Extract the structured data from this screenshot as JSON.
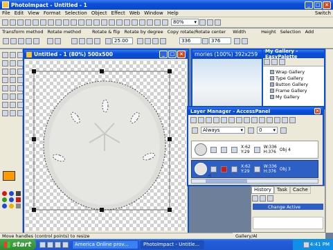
{
  "app": {
    "title": "PhotoImpact - Untitled - 1",
    "switch_label": "Switch"
  },
  "menu": [
    "File",
    "Edit",
    "View",
    "Format",
    "Selection",
    "Object",
    "Effect",
    "Web",
    "Window",
    "Help"
  ],
  "toolbar": {
    "zoom_value": "80%"
  },
  "options_bar": {
    "transform_method": "Transform method",
    "rotate_method": "Rotate method",
    "rotate_flip": "Rotate & flip",
    "rotate_by_degree": "Rotate by degree",
    "rotate_value": "25.00",
    "copy_rotate": "Copy rotate/Rotate center",
    "width_label": "Width",
    "width_value": "336",
    "height_label": "Height",
    "height_value": "376",
    "selection_label": "Selection",
    "add_label": "Add"
  },
  "doc_window": {
    "title": "Untitled - 1 (80%) 500x500"
  },
  "bg_window": {
    "title": "rnories (100%) 392x259"
  },
  "gallery": {
    "title": "My Gallery - EasyPalette",
    "items": [
      "Wrap Gallery",
      "Type Gallery",
      "Button Gallery",
      "Frame Gallery",
      "My Gallery"
    ]
  },
  "layer_manager": {
    "title": "Layer Manager - AccessPanel",
    "mode": "Always",
    "opacity": "0",
    "layers": [
      {
        "x": "X:62",
        "y": "Y:29",
        "w": "W:336",
        "h": "H:376",
        "name": "Obj 4"
      },
      {
        "x": "X:62",
        "y": "Y:29",
        "w": "W:336",
        "h": "H:376",
        "name": "Obj 3"
      }
    ]
  },
  "history": {
    "tabs": [
      "History",
      "Task",
      "Cache"
    ],
    "action": "Change Active"
  },
  "gallery_album_label": "Gallery/Al",
  "status_text": "Move handles (control points) to resize",
  "taskbar": {
    "start": "start",
    "tasks": [
      "America Online prov...",
      "PhotoImpact - Untitle..."
    ],
    "clock": "4:41 PM"
  },
  "colors": {
    "title_blue": "#0a4fd8",
    "close_red": "#d8461e",
    "face": "#ece9d8",
    "desktop": "#6e7f9a"
  }
}
